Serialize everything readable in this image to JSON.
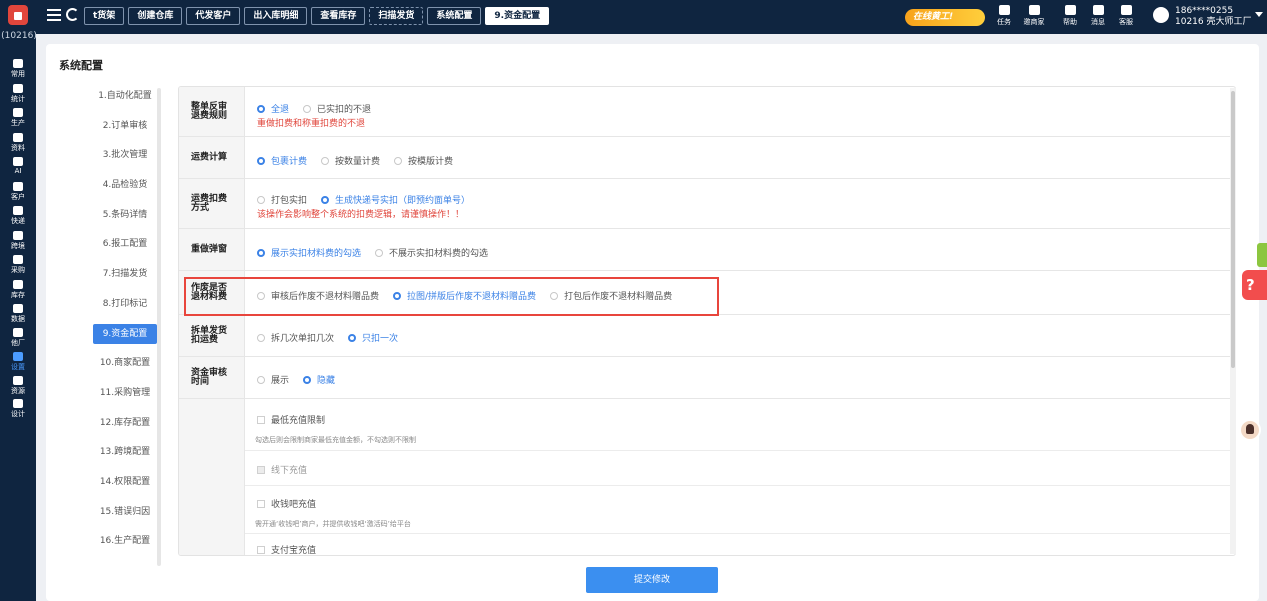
{
  "app": {
    "shop_code": "(10216)"
  },
  "topbar": {
    "tabs": [
      {
        "label": "t货架",
        "active": false
      },
      {
        "label": "创建仓库",
        "active": false
      },
      {
        "label": "代发客户",
        "active": false
      },
      {
        "label": "出入库明细",
        "active": false
      },
      {
        "label": "查看库存",
        "active": false
      },
      {
        "label": "扫描发货",
        "active": false
      },
      {
        "label": "系统配置",
        "active": false
      },
      {
        "label": "9.资金配置",
        "active": true
      }
    ],
    "promo_label": "在线黄工!",
    "tools": [
      "任务",
      "邀商家",
      "帮助",
      "消息",
      "客服"
    ],
    "user": {
      "phone": "186****0255",
      "account": "10216 壳大师工厂"
    }
  },
  "sidebar": {
    "items": [
      "常用",
      "统计",
      "生产",
      "资料",
      "AI",
      "客户",
      "快递",
      "跨境",
      "采购",
      "库存",
      "数据",
      "他厂",
      "设置",
      "资源",
      "设计"
    ],
    "active": "设置"
  },
  "page": {
    "title": "系统配置",
    "nav": [
      "1.自动化配置",
      "2.订单审核",
      "3.批次管理",
      "4.品检验货",
      "5.条码详情",
      "6.报工配置",
      "7.扫描发货",
      "8.打印标记",
      "9.资金配置",
      "10.商家配置",
      "11.采购管理",
      "12.库存配置",
      "13.跨境配置",
      "14.权限配置",
      "15.错误归因",
      "16.生产配置"
    ],
    "active_nav": "9.资金配置"
  },
  "settings": {
    "refund_rule": {
      "label": "整单反审退费规则",
      "options": [
        "全退",
        "已实扣的不退"
      ],
      "selected": "全退",
      "note": "重做扣费和称重扣费的不退"
    },
    "freight_calc": {
      "label": "运费计算",
      "options": [
        "包裹计费",
        "按数量计费",
        "按模版计费"
      ],
      "selected": "包裹计费"
    },
    "freight_deduct": {
      "label": "运费扣费方式",
      "options": [
        "打包实扣",
        "生成快递号实扣（即预约面单号）"
      ],
      "selected": "生成快递号实扣（即预约面单号）",
      "note": "该操作会影响整个系统的扣费逻辑，请谨慎操作！！"
    },
    "redo_popup": {
      "label": "重做弹窗",
      "options": [
        "展示实扣材料费的勾选",
        "不展示实扣材料费的勾选"
      ],
      "selected": "展示实扣材料费的勾选"
    },
    "scrap_refund": {
      "label": "作废是否退材料费",
      "options": [
        "审核后作废不退材料赠品费",
        "拉图/拼版后作废不退材料赠品费",
        "打包后作废不退材料赠品费"
      ],
      "selected": "拉图/拼版后作废不退材料赠品费"
    },
    "split_ship": {
      "label": "拆单发货扣运费",
      "options": [
        "拆几次单扣几次",
        "只扣一次"
      ],
      "selected": "只扣一次"
    },
    "fund_review": {
      "label": "资金审核时间",
      "options": [
        "展示",
        "隐藏"
      ],
      "selected": "隐藏"
    },
    "recharge": {
      "min_limit": {
        "label": "最低充值限制",
        "hint": "勾选后则会限制商家最低充值金额，不勾选则不限制"
      },
      "offline": {
        "label": "线下充值"
      },
      "shouqianba": {
        "label": "收钱吧充值",
        "hint": "需开通‘收钱吧’商户，并提供收钱吧‘激活码’给平台"
      },
      "alipay": {
        "label": "支付宝充值"
      }
    }
  },
  "actions": {
    "submit_label": "提交修改"
  }
}
